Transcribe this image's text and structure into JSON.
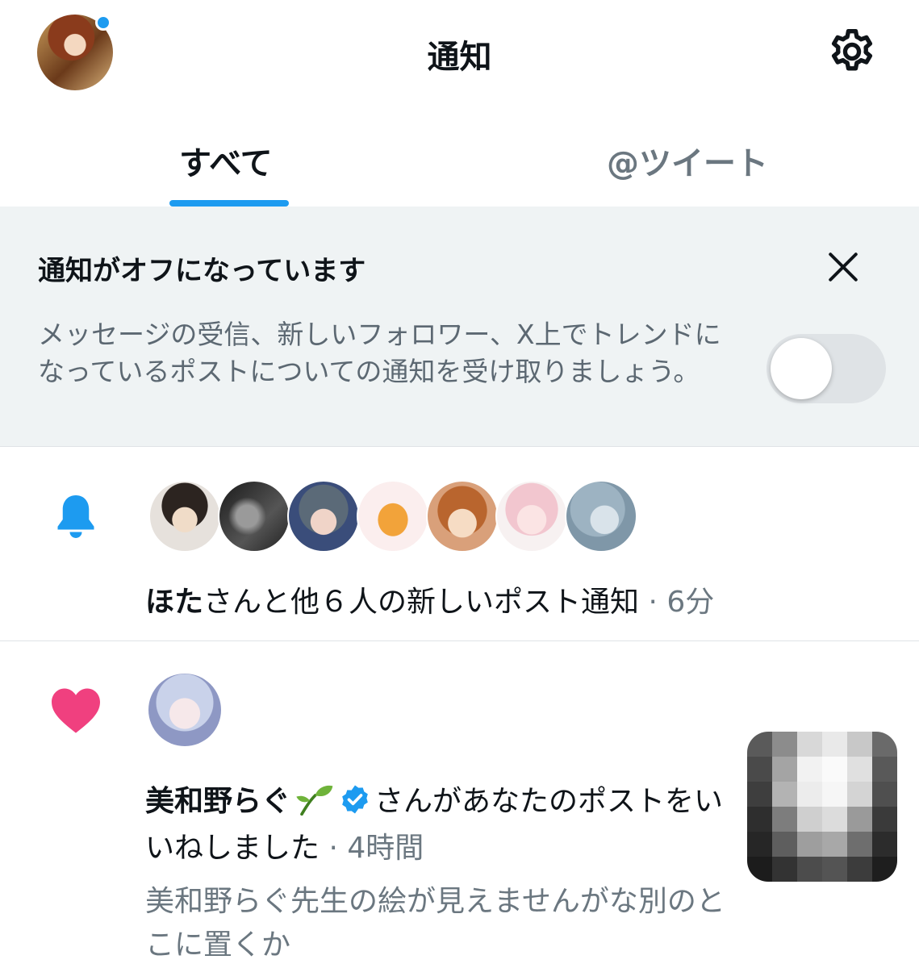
{
  "header": {
    "title": "通知",
    "settings_icon": "gear-icon",
    "unread_dot_color": "#1d9bf0"
  },
  "tabs": [
    {
      "label": "すべて",
      "active": true
    },
    {
      "label": "@ツイート",
      "active": false
    }
  ],
  "banner": {
    "title": "通知がオフになっています",
    "body": "メッセージの受信、新しいフォロワー、X上でトレンドになっているポストについての通知を受け取りましょう。",
    "toggle_on": false
  },
  "notifications": [
    {
      "type": "new-posts",
      "icon": "bell-icon",
      "name": "ほた",
      "text": "さんと他６人の新しいポスト通知",
      "time": "· 6分"
    },
    {
      "type": "like",
      "icon": "heart-icon",
      "name": "美和野らぐ",
      "name_emoji": "sprout-icon",
      "verified": true,
      "text": "さんがあなたのポストをいいねしました",
      "time": "· 4時間",
      "preview": "美和野らぐ先生の絵が見えませんがな別のとこに置くか"
    }
  ],
  "colors": {
    "accent": "#1d9bf0",
    "like": "#f91880",
    "muted": "#6b7780",
    "banner_bg": "#eff3f4"
  }
}
